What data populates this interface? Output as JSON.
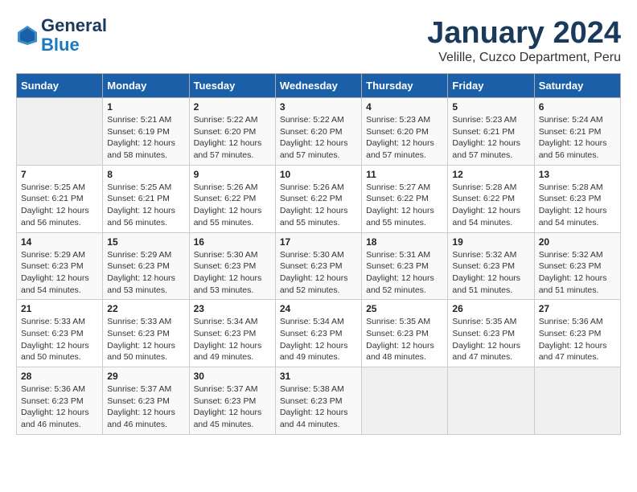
{
  "header": {
    "logo_line1": "General",
    "logo_line2": "Blue",
    "month_title": "January 2024",
    "subtitle": "Velille, Cuzco Department, Peru"
  },
  "weekdays": [
    "Sunday",
    "Monday",
    "Tuesday",
    "Wednesday",
    "Thursday",
    "Friday",
    "Saturday"
  ],
  "weeks": [
    [
      {
        "day": "",
        "info": ""
      },
      {
        "day": "1",
        "info": "Sunrise: 5:21 AM\nSunset: 6:19 PM\nDaylight: 12 hours\nand 58 minutes."
      },
      {
        "day": "2",
        "info": "Sunrise: 5:22 AM\nSunset: 6:20 PM\nDaylight: 12 hours\nand 57 minutes."
      },
      {
        "day": "3",
        "info": "Sunrise: 5:22 AM\nSunset: 6:20 PM\nDaylight: 12 hours\nand 57 minutes."
      },
      {
        "day": "4",
        "info": "Sunrise: 5:23 AM\nSunset: 6:20 PM\nDaylight: 12 hours\nand 57 minutes."
      },
      {
        "day": "5",
        "info": "Sunrise: 5:23 AM\nSunset: 6:21 PM\nDaylight: 12 hours\nand 57 minutes."
      },
      {
        "day": "6",
        "info": "Sunrise: 5:24 AM\nSunset: 6:21 PM\nDaylight: 12 hours\nand 56 minutes."
      }
    ],
    [
      {
        "day": "7",
        "info": "Sunrise: 5:25 AM\nSunset: 6:21 PM\nDaylight: 12 hours\nand 56 minutes."
      },
      {
        "day": "8",
        "info": "Sunrise: 5:25 AM\nSunset: 6:21 PM\nDaylight: 12 hours\nand 56 minutes."
      },
      {
        "day": "9",
        "info": "Sunrise: 5:26 AM\nSunset: 6:22 PM\nDaylight: 12 hours\nand 55 minutes."
      },
      {
        "day": "10",
        "info": "Sunrise: 5:26 AM\nSunset: 6:22 PM\nDaylight: 12 hours\nand 55 minutes."
      },
      {
        "day": "11",
        "info": "Sunrise: 5:27 AM\nSunset: 6:22 PM\nDaylight: 12 hours\nand 55 minutes."
      },
      {
        "day": "12",
        "info": "Sunrise: 5:28 AM\nSunset: 6:22 PM\nDaylight: 12 hours\nand 54 minutes."
      },
      {
        "day": "13",
        "info": "Sunrise: 5:28 AM\nSunset: 6:23 PM\nDaylight: 12 hours\nand 54 minutes."
      }
    ],
    [
      {
        "day": "14",
        "info": "Sunrise: 5:29 AM\nSunset: 6:23 PM\nDaylight: 12 hours\nand 54 minutes."
      },
      {
        "day": "15",
        "info": "Sunrise: 5:29 AM\nSunset: 6:23 PM\nDaylight: 12 hours\nand 53 minutes."
      },
      {
        "day": "16",
        "info": "Sunrise: 5:30 AM\nSunset: 6:23 PM\nDaylight: 12 hours\nand 53 minutes."
      },
      {
        "day": "17",
        "info": "Sunrise: 5:30 AM\nSunset: 6:23 PM\nDaylight: 12 hours\nand 52 minutes."
      },
      {
        "day": "18",
        "info": "Sunrise: 5:31 AM\nSunset: 6:23 PM\nDaylight: 12 hours\nand 52 minutes."
      },
      {
        "day": "19",
        "info": "Sunrise: 5:32 AM\nSunset: 6:23 PM\nDaylight: 12 hours\nand 51 minutes."
      },
      {
        "day": "20",
        "info": "Sunrise: 5:32 AM\nSunset: 6:23 PM\nDaylight: 12 hours\nand 51 minutes."
      }
    ],
    [
      {
        "day": "21",
        "info": "Sunrise: 5:33 AM\nSunset: 6:23 PM\nDaylight: 12 hours\nand 50 minutes."
      },
      {
        "day": "22",
        "info": "Sunrise: 5:33 AM\nSunset: 6:23 PM\nDaylight: 12 hours\nand 50 minutes."
      },
      {
        "day": "23",
        "info": "Sunrise: 5:34 AM\nSunset: 6:23 PM\nDaylight: 12 hours\nand 49 minutes."
      },
      {
        "day": "24",
        "info": "Sunrise: 5:34 AM\nSunset: 6:23 PM\nDaylight: 12 hours\nand 49 minutes."
      },
      {
        "day": "25",
        "info": "Sunrise: 5:35 AM\nSunset: 6:23 PM\nDaylight: 12 hours\nand 48 minutes."
      },
      {
        "day": "26",
        "info": "Sunrise: 5:35 AM\nSunset: 6:23 PM\nDaylight: 12 hours\nand 47 minutes."
      },
      {
        "day": "27",
        "info": "Sunrise: 5:36 AM\nSunset: 6:23 PM\nDaylight: 12 hours\nand 47 minutes."
      }
    ],
    [
      {
        "day": "28",
        "info": "Sunrise: 5:36 AM\nSunset: 6:23 PM\nDaylight: 12 hours\nand 46 minutes."
      },
      {
        "day": "29",
        "info": "Sunrise: 5:37 AM\nSunset: 6:23 PM\nDaylight: 12 hours\nand 46 minutes."
      },
      {
        "day": "30",
        "info": "Sunrise: 5:37 AM\nSunset: 6:23 PM\nDaylight: 12 hours\nand 45 minutes."
      },
      {
        "day": "31",
        "info": "Sunrise: 5:38 AM\nSunset: 6:23 PM\nDaylight: 12 hours\nand 44 minutes."
      },
      {
        "day": "",
        "info": ""
      },
      {
        "day": "",
        "info": ""
      },
      {
        "day": "",
        "info": ""
      }
    ]
  ]
}
